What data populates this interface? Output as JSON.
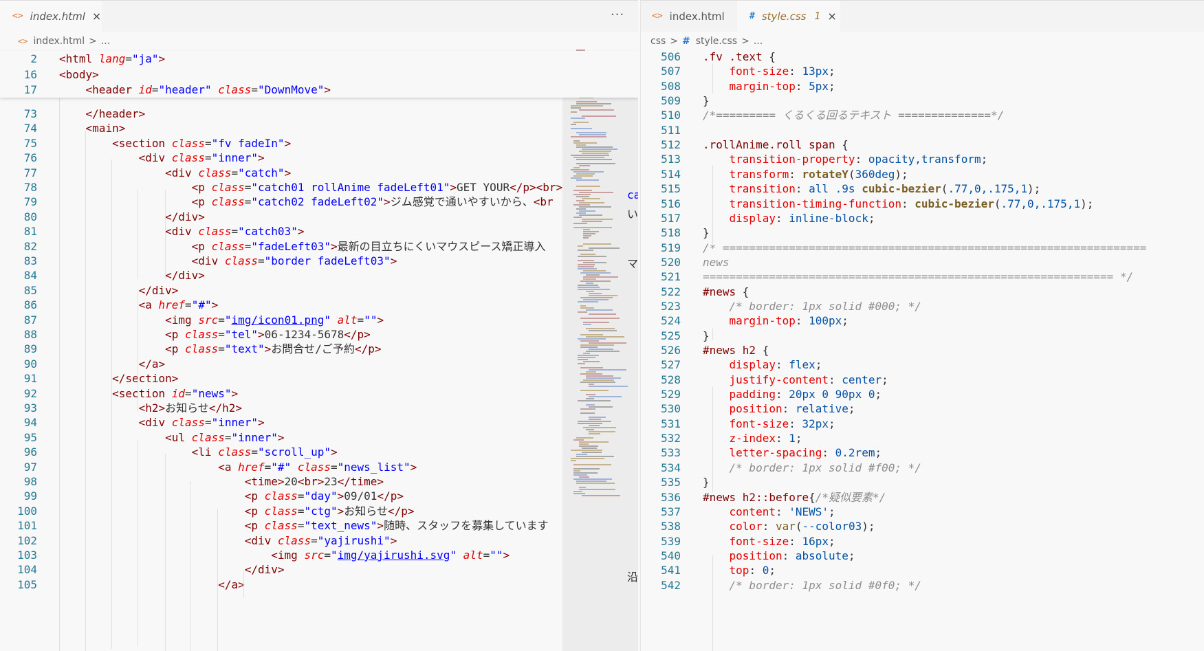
{
  "left": {
    "tabs": [
      {
        "label": "index.html",
        "icon": "<>",
        "close": "×"
      }
    ],
    "more": "···",
    "breadcrumb": {
      "icon": "<>",
      "file": "index.html",
      "sep": ">",
      "rest": "..."
    },
    "sticky": [
      {
        "n": "2",
        "html": "<span class='p'>&lt;</span><span class='t'>html</span> <span class='a'>lang</span>=<span class='s'>\"ja\"</span><span class='p'>&gt;</span>"
      },
      {
        "n": "16",
        "html": "<span class='p'>&lt;</span><span class='t'>body</span><span class='p'>&gt;</span>"
      },
      {
        "n": "17",
        "html": "    <span class='p'>&lt;</span><span class='t'>header</span> <span class='a'>id</span>=<span class='s'>\"header\"</span> <span class='a'>class</span>=<span class='s'>\"DownMove\"</span><span class='p'>&gt;</span>"
      }
    ],
    "lines": [
      {
        "n": "73",
        "html": "    <span class='p'>&lt;/</span><span class='t'>header</span><span class='p'>&gt;</span>"
      },
      {
        "n": "74",
        "html": "    <span class='p'>&lt;</span><span class='t'>main</span><span class='p'>&gt;</span>"
      },
      {
        "n": "75",
        "html": "        <span class='p'>&lt;</span><span class='t'>section</span> <span class='a'>class</span>=<span class='s'>\"fv fadeIn\"</span><span class='p'>&gt;</span>"
      },
      {
        "n": "76",
        "html": "            <span class='p'>&lt;</span><span class='t'>div</span> <span class='a'>class</span>=<span class='s'>\"inner\"</span><span class='p'>&gt;</span>"
      },
      {
        "n": "77",
        "html": "                <span class='p'>&lt;</span><span class='t'>div</span> <span class='a'>class</span>=<span class='s'>\"catch\"</span><span class='p'>&gt;</span>"
      },
      {
        "n": "78",
        "html": "                    <span class='p'>&lt;</span><span class='t'>p</span> <span class='a'>class</span>=<span class='s'>\"catch01 rollAnime fadeLeft01\"</span><span class='p'>&gt;</span>GET YOUR<span class='p'>&lt;/</span><span class='t'>p</span><span class='p'>&gt;&lt;</span><span class='t'>br</span><span class='p'>&gt;&lt;</span>"
      },
      {
        "n": "79",
        "html": "                    <span class='p'>&lt;</span><span class='t'>p</span> <span class='a'>class</span>=<span class='s'>\"catch02 fadeLeft02\"</span><span class='p'>&gt;</span>ジム感覚で通いやすいから、<span class='p'>&lt;</span><span class='t'>br</span>"
      },
      {
        "n": "80",
        "html": "                <span class='p'>&lt;/</span><span class='t'>div</span><span class='p'>&gt;</span>"
      },
      {
        "n": "81",
        "html": "                <span class='p'>&lt;</span><span class='t'>div</span> <span class='a'>class</span>=<span class='s'>\"catch03\"</span><span class='p'>&gt;</span>"
      },
      {
        "n": "82",
        "html": "                    <span class='p'>&lt;</span><span class='t'>p</span> <span class='a'>class</span>=<span class='s'>\"fadeLeft03\"</span><span class='p'>&gt;</span>最新の目立ちにくいマウスピース矯正導入"
      },
      {
        "n": "83",
        "html": "                    <span class='p'>&lt;</span><span class='t'>div</span> <span class='a'>class</span>=<span class='s'>\"border fadeLeft03\"</span><span class='p'>&gt;</span>"
      },
      {
        "n": "84",
        "html": "                <span class='p'>&lt;/</span><span class='t'>div</span><span class='p'>&gt;</span>"
      },
      {
        "n": "85",
        "html": "            <span class='p'>&lt;/</span><span class='t'>div</span><span class='p'>&gt;</span>"
      },
      {
        "n": "86",
        "html": "            <span class='p'>&lt;</span><span class='t'>a</span> <span class='a'>href</span>=<span class='s'>\"#\"</span><span class='p'>&gt;</span>"
      },
      {
        "n": "87",
        "html": "                <span class='p'>&lt;</span><span class='t'>img</span> <span class='a'>src</span>=<span class='s'>\"<span class='u'>img/icon01.png</span>\"</span> <span class='a'>alt</span>=<span class='s'>\"\"</span><span class='p'>&gt;</span>"
      },
      {
        "n": "88",
        "html": "                <span class='p'>&lt;</span><span class='t'>p</span> <span class='a'>class</span>=<span class='s'>\"tel\"</span><span class='p'>&gt;</span>06-1234-5678<span class='p'>&lt;/</span><span class='t'>p</span><span class='p'>&gt;</span>"
      },
      {
        "n": "89",
        "html": "                <span class='p'>&lt;</span><span class='t'>p</span> <span class='a'>class</span>=<span class='s'>\"text\"</span><span class='p'>&gt;</span>お問合せ/ご予約<span class='p'>&lt;/</span><span class='t'>p</span><span class='p'>&gt;</span>"
      },
      {
        "n": "90",
        "html": "            <span class='p'>&lt;/</span><span class='t'>a</span><span class='p'>&gt;</span>"
      },
      {
        "n": "91",
        "html": "        <span class='p'>&lt;/</span><span class='t'>section</span><span class='p'>&gt;</span>"
      },
      {
        "n": "92",
        "html": "        <span class='p'>&lt;</span><span class='t'>section</span> <span class='a'>id</span>=<span class='s'>\"news\"</span><span class='p'>&gt;</span>"
      },
      {
        "n": "93",
        "html": "            <span class='p'>&lt;</span><span class='t'>h2</span><span class='p'>&gt;</span>お知らせ<span class='p'>&lt;/</span><span class='t'>h2</span><span class='p'>&gt;</span>"
      },
      {
        "n": "94",
        "html": "            <span class='p'>&lt;</span><span class='t'>div</span> <span class='a'>class</span>=<span class='s'>\"inner\"</span><span class='p'>&gt;</span>"
      },
      {
        "n": "95",
        "html": "                <span class='p'>&lt;</span><span class='t'>ul</span> <span class='a'>class</span>=<span class='s'>\"inner\"</span><span class='p'>&gt;</span>"
      },
      {
        "n": "96",
        "html": "                    <span class='p'>&lt;</span><span class='t'>li</span> <span class='a'>class</span>=<span class='s'>\"scroll_up\"</span><span class='p'>&gt;</span>"
      },
      {
        "n": "97",
        "html": "                        <span class='p'>&lt;</span><span class='t'>a</span> <span class='a'>href</span>=<span class='s'>\"#\"</span> <span class='a'>class</span>=<span class='s'>\"news_list\"</span><span class='p'>&gt;</span>"
      },
      {
        "n": "98",
        "html": "                            <span class='p'>&lt;</span><span class='t'>time</span><span class='p'>&gt;</span>20<span class='p'>&lt;</span><span class='t'>br</span><span class='p'>&gt;</span>23<span class='p'>&lt;/</span><span class='t'>time</span><span class='p'>&gt;</span>"
      },
      {
        "n": "99",
        "html": "                            <span class='p'>&lt;</span><span class='t'>p</span> <span class='a'>class</span>=<span class='s'>\"day\"</span><span class='p'>&gt;</span>09/01<span class='p'>&lt;/</span><span class='t'>p</span><span class='p'>&gt;</span>"
      },
      {
        "n": "100",
        "html": "                            <span class='p'>&lt;</span><span class='t'>p</span> <span class='a'>class</span>=<span class='s'>\"ctg\"</span><span class='p'>&gt;</span>お知らせ<span class='p'>&lt;/</span><span class='t'>p</span><span class='p'>&gt;</span>"
      },
      {
        "n": "101",
        "html": "                            <span class='p'>&lt;</span><span class='t'>p</span> <span class='a'>class</span>=<span class='s'>\"text_news\"</span><span class='p'>&gt;</span>随時、スタッフを募集しています"
      },
      {
        "n": "102",
        "html": "                            <span class='p'>&lt;</span><span class='t'>div</span> <span class='a'>class</span>=<span class='s'>\"yajirushi\"</span><span class='p'>&gt;</span>"
      },
      {
        "n": "103",
        "html": "                                <span class='p'>&lt;</span><span class='t'>img</span> <span class='a'>src</span>=<span class='s'>\"<span class='u'>img/yajirushi.svg</span>\"</span> <span class='a'>alt</span>=<span class='s'>\"\"</span><span class='p'>&gt;</span>"
      },
      {
        "n": "104",
        "html": "                            <span class='p'>&lt;/</span><span class='t'>div</span><span class='p'>&gt;</span>"
      },
      {
        "n": "105",
        "html": "                        <span class='p'>&lt;/</span><span class='t'>a</span><span class='p'>&gt;</span>"
      }
    ],
    "overflow_fragments": [
      "ca",
      "い",
      "マ",
      "沿"
    ]
  },
  "right": {
    "tabs": [
      {
        "label": "index.html",
        "icon": "<>",
        "italic": false
      },
      {
        "label": "style.css",
        "icon": "#",
        "italic": true,
        "modified": "1",
        "close": "×"
      }
    ],
    "breadcrumb": {
      "folder": "css",
      "sep": ">",
      "icon": "#",
      "file": "style.css",
      "rest": "..."
    },
    "lines": [
      {
        "n": "506",
        "html": "<span class='sel'>.fv .text</span> {"
      },
      {
        "n": "507",
        "html": "    <span class='prop'>font-size</span>: <span class='val'>13px</span>;"
      },
      {
        "n": "508",
        "html": "    <span class='prop'>margin-top</span>: <span class='val'>5px</span>;"
      },
      {
        "n": "509",
        "html": "}"
      },
      {
        "n": "510",
        "html": "<span class='c'>/*========= くるくる回るテキスト ==============*/</span>"
      },
      {
        "n": "511",
        "html": ""
      },
      {
        "n": "512",
        "html": "<span class='sel'>.rollAnime.roll span</span> {"
      },
      {
        "n": "513",
        "html": "    <span class='prop'>transition-property</span>: <span class='val'>opacity,transform</span>;"
      },
      {
        "n": "514",
        "html": "    <span class='prop'>transform</span>: <span class='fn'>rotateY</span>(<span class='val'>360deg</span>);"
      },
      {
        "n": "515",
        "html": "    <span class='prop'>transition</span>: <span class='val'>all .9s</span> <span class='fn'>cubic-bezier</span>(<span class='val'>.77,0,.175,1</span>);"
      },
      {
        "n": "516",
        "html": "    <span class='prop'>transition-timing-function</span>: <span class='fn'>cubic-bezier</span>(<span class='val'>.77,0,.175,1</span>);"
      },
      {
        "n": "517",
        "html": "    <span class='prop'>display</span>: <span class='val'>inline-block</span>;"
      },
      {
        "n": "518",
        "html": "}"
      },
      {
        "n": "519",
        "html": "<span class='c'>/* ================================================================</span>"
      },
      {
        "n": "520",
        "html": "<span class='c'>news</span>"
      },
      {
        "n": "521",
        "html": "<span class='c'>============================================================== */</span>"
      },
      {
        "n": "522",
        "html": "<span class='sel'>#news</span> {"
      },
      {
        "n": "523",
        "html": "    <span class='c'>/* border: 1px solid #000; */</span>"
      },
      {
        "n": "524",
        "html": "    <span class='prop'>margin-top</span>: <span class='val'>100px</span>;"
      },
      {
        "n": "525",
        "html": "}"
      },
      {
        "n": "526",
        "html": "<span class='sel'>#news h2</span> {"
      },
      {
        "n": "527",
        "html": "    <span class='prop'>display</span>: <span class='val'>flex</span>;"
      },
      {
        "n": "528",
        "html": "    <span class='prop'>justify-content</span>: <span class='val'>center</span>;"
      },
      {
        "n": "529",
        "html": "    <span class='prop'>padding</span>: <span class='val'>20px 0 90px 0</span>;"
      },
      {
        "n": "530",
        "html": "    <span class='prop'>position</span>: <span class='val'>relative</span>;"
      },
      {
        "n": "531",
        "html": "    <span class='prop'>font-size</span>: <span class='val'>32px</span>;"
      },
      {
        "n": "532",
        "html": "    <span class='prop'>z-index</span>: <span class='val'>1</span>;"
      },
      {
        "n": "533",
        "html": "    <span class='prop'>letter-spacing</span>: <span class='val'>0.2rem</span>;"
      },
      {
        "n": "534",
        "html": "    <span class='c'>/* border: 1px solid #f00; */</span>"
      },
      {
        "n": "535",
        "html": "}"
      },
      {
        "n": "536",
        "html": "<span class='sel'>#news h2::before</span>{<span class='c'>/*疑似要素*/</span>"
      },
      {
        "n": "537",
        "html": "    <span class='prop'>content</span>: <span class='val'>'NEWS'</span>;"
      },
      {
        "n": "538",
        "html": "    <span class='prop'>color</span>: <span class='fn' style='font-weight:normal;color:#795e26'>var</span>(<span class='val'>--color03</span>);"
      },
      {
        "n": "539",
        "html": "    <span class='prop'>font-size</span>: <span class='val'>16px</span>;"
      },
      {
        "n": "540",
        "html": "    <span class='prop'>position</span>: <span class='val'>absolute</span>;"
      },
      {
        "n": "541",
        "html": "    <span class='prop'>top</span>: <span class='val'>0</span>;"
      },
      {
        "n": "542",
        "html": "    <span class='c'>/* border: 1px solid #0f0; */</span>"
      }
    ]
  }
}
